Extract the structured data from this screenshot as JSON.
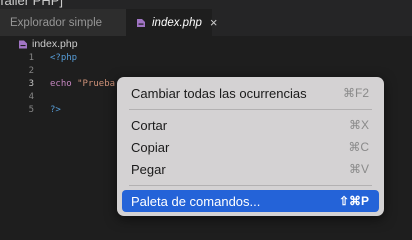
{
  "window": {
    "title": "Taller PHP]"
  },
  "tabs": [
    {
      "label": "Explorador simple",
      "active": false
    },
    {
      "label": "index.php",
      "active": true,
      "close": "×"
    }
  ],
  "breadcrumb": {
    "file": "index.php"
  },
  "editor": {
    "lines": [
      {
        "number": "1",
        "open_tag": "<?php"
      },
      {
        "number": "2"
      },
      {
        "number": "3",
        "keyword": "echo",
        "string": "\"Prueba"
      },
      {
        "number": "4"
      },
      {
        "number": "5",
        "close_tag": "?>"
      }
    ]
  },
  "context_menu": {
    "items": [
      {
        "label": "Cambiar todas las ocurrencias",
        "shortcut": "⌘F2"
      },
      {
        "label": "Cortar",
        "shortcut": "⌘X"
      },
      {
        "label": "Copiar",
        "shortcut": "⌘C"
      },
      {
        "label": "Pegar",
        "shortcut": "⌘V"
      },
      {
        "label": "Paleta de comandos...",
        "shortcut": "⇧⌘P",
        "highlighted": true
      }
    ]
  },
  "colors": {
    "php_icon": "#a074c4",
    "menu_highlight": "#2463d8",
    "editor_bg": "#1e1e1e"
  }
}
